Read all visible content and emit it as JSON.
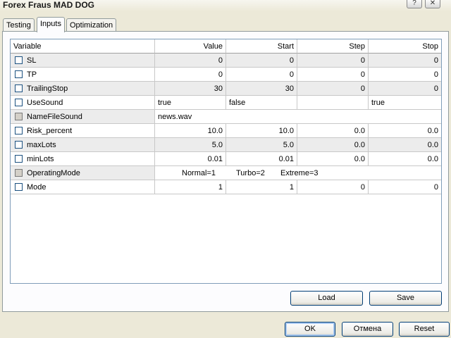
{
  "window": {
    "title": "Forex Fraus MAD DOG",
    "help_glyph": "?",
    "close_glyph": "✕"
  },
  "tabs": [
    {
      "label": "Testing"
    },
    {
      "label": "Inputs"
    },
    {
      "label": "Optimization"
    }
  ],
  "grid": {
    "columns": [
      "Variable",
      "Value",
      "Start",
      "Step",
      "Stop"
    ],
    "rows": [
      {
        "name": "SL",
        "value": "0",
        "start": "0",
        "step": "0",
        "stop": "0"
      },
      {
        "name": "TP",
        "value": "0",
        "start": "0",
        "step": "0",
        "stop": "0"
      },
      {
        "name": "TrailingStop",
        "value": "30",
        "start": "30",
        "step": "0",
        "stop": "0"
      },
      {
        "name": "UseSound",
        "value": "true",
        "start": "false",
        "step": "",
        "stop": "true"
      },
      {
        "name": "NameFileSound",
        "value": "news.wav"
      },
      {
        "name": "Risk_percent",
        "value": "10.0",
        "start": "10.0",
        "step": "0.0",
        "stop": "0.0"
      },
      {
        "name": "maxLots",
        "value": "5.0",
        "start": "5.0",
        "step": "0.0",
        "stop": "0.0"
      },
      {
        "name": "minLots",
        "value": "0.01",
        "start": "0.01",
        "step": "0.0",
        "stop": "0.0"
      },
      {
        "name": "OperatingMode",
        "options": [
          "Normal=1",
          "Turbo=2",
          "Extreme=3"
        ]
      },
      {
        "name": "Mode",
        "value": "1",
        "start": "1",
        "step": "0",
        "stop": "0"
      }
    ]
  },
  "buttons": {
    "load": "Load",
    "save": "Save",
    "ok": "OK",
    "cancel": "Отмена",
    "reset": "Reset"
  }
}
